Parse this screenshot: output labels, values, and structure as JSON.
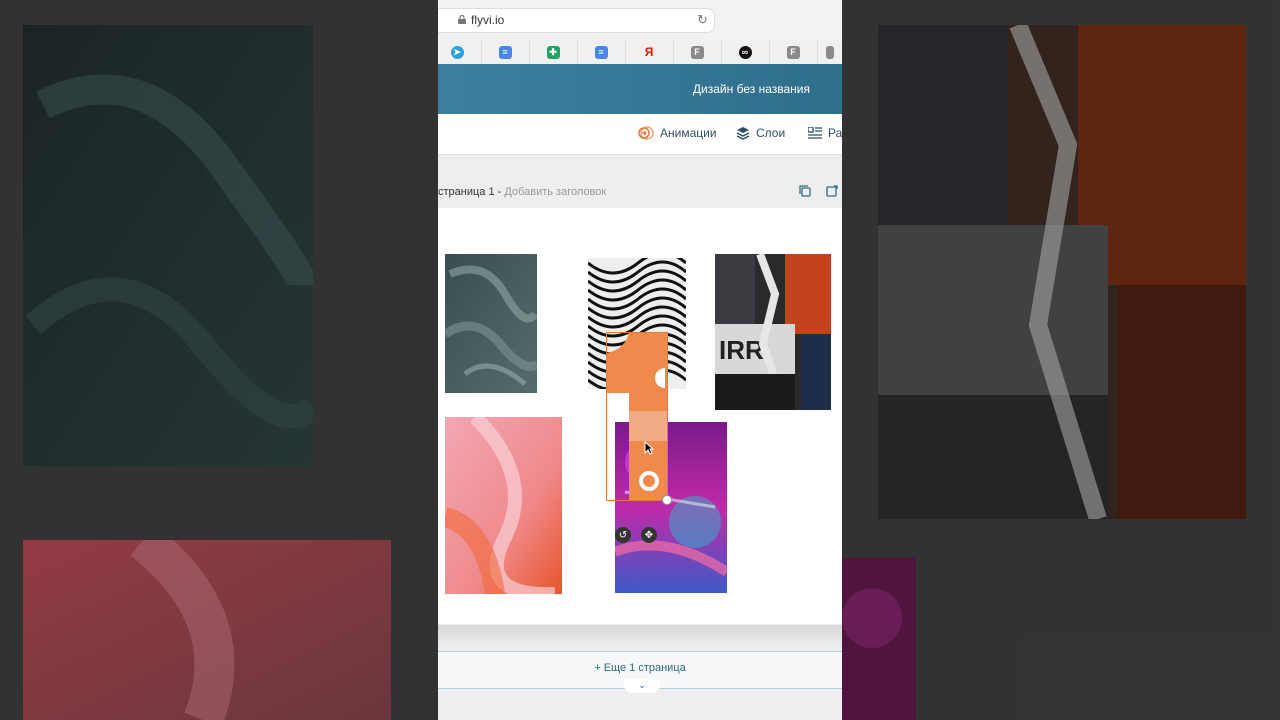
{
  "browser": {
    "url": "flyvi.io",
    "tabs": [
      {
        "icon": "telegram-icon",
        "color": "#2aa1da"
      },
      {
        "icon": "docs-icon",
        "color": "#4a86e8"
      },
      {
        "icon": "sheets-icon",
        "color": "#1fa463"
      },
      {
        "icon": "docs-icon",
        "color": "#4a86e8"
      },
      {
        "icon": "yandex-icon",
        "color": "#e61400",
        "glyph": "Я"
      },
      {
        "icon": "f-icon",
        "color": "#8a8a8a",
        "glyph": "F"
      },
      {
        "icon": "ring-icon",
        "color": "#111111",
        "glyph": "∞"
      },
      {
        "icon": "f-icon",
        "color": "#8a8a8a",
        "glyph": "F"
      }
    ]
  },
  "header": {
    "title": "Дизайн без названия"
  },
  "toolbar": {
    "animations": "Анимации",
    "layers": "Слои",
    "third": "Ра"
  },
  "page": {
    "label": "страница 1 -",
    "add_title": "Добавить заголовок"
  },
  "footer": {
    "more_pages": "+ Еще 1 страница"
  },
  "colors": {
    "accent": "#e07a3c",
    "header": "#3c7f9e",
    "link": "#2e6b84"
  }
}
